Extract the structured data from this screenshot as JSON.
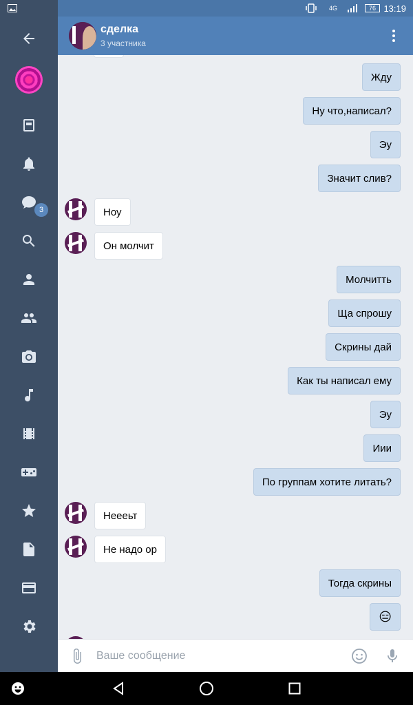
{
  "status": {
    "network": "4G",
    "battery": "76",
    "time": "13:19"
  },
  "sidebar": {
    "messages_badge": "3"
  },
  "header": {
    "title": "сделка",
    "subtitle": "3 участника"
  },
  "messages": [
    {
      "text": "Жду"
    },
    {
      "text": "Ну что,написал?"
    },
    {
      "text": "Эу"
    },
    {
      "text": "Значит слив?"
    },
    {
      "text": "Ноу"
    },
    {
      "text": "Он молчит"
    },
    {
      "text": "Молчитть"
    },
    {
      "text": "Ща спрошу"
    },
    {
      "text": "Скрины дай"
    },
    {
      "text": "Как ты написал ему"
    },
    {
      "text": "Эу"
    },
    {
      "text": "Иии"
    },
    {
      "text": "По группам хотите литать?"
    },
    {
      "text": "Неееьт"
    },
    {
      "text": "Не надо ор"
    },
    {
      "text": "Тогда скрины"
    },
    {
      "text": "😑"
    }
  ],
  "composer": {
    "placeholder": "Ваше сообщение"
  }
}
